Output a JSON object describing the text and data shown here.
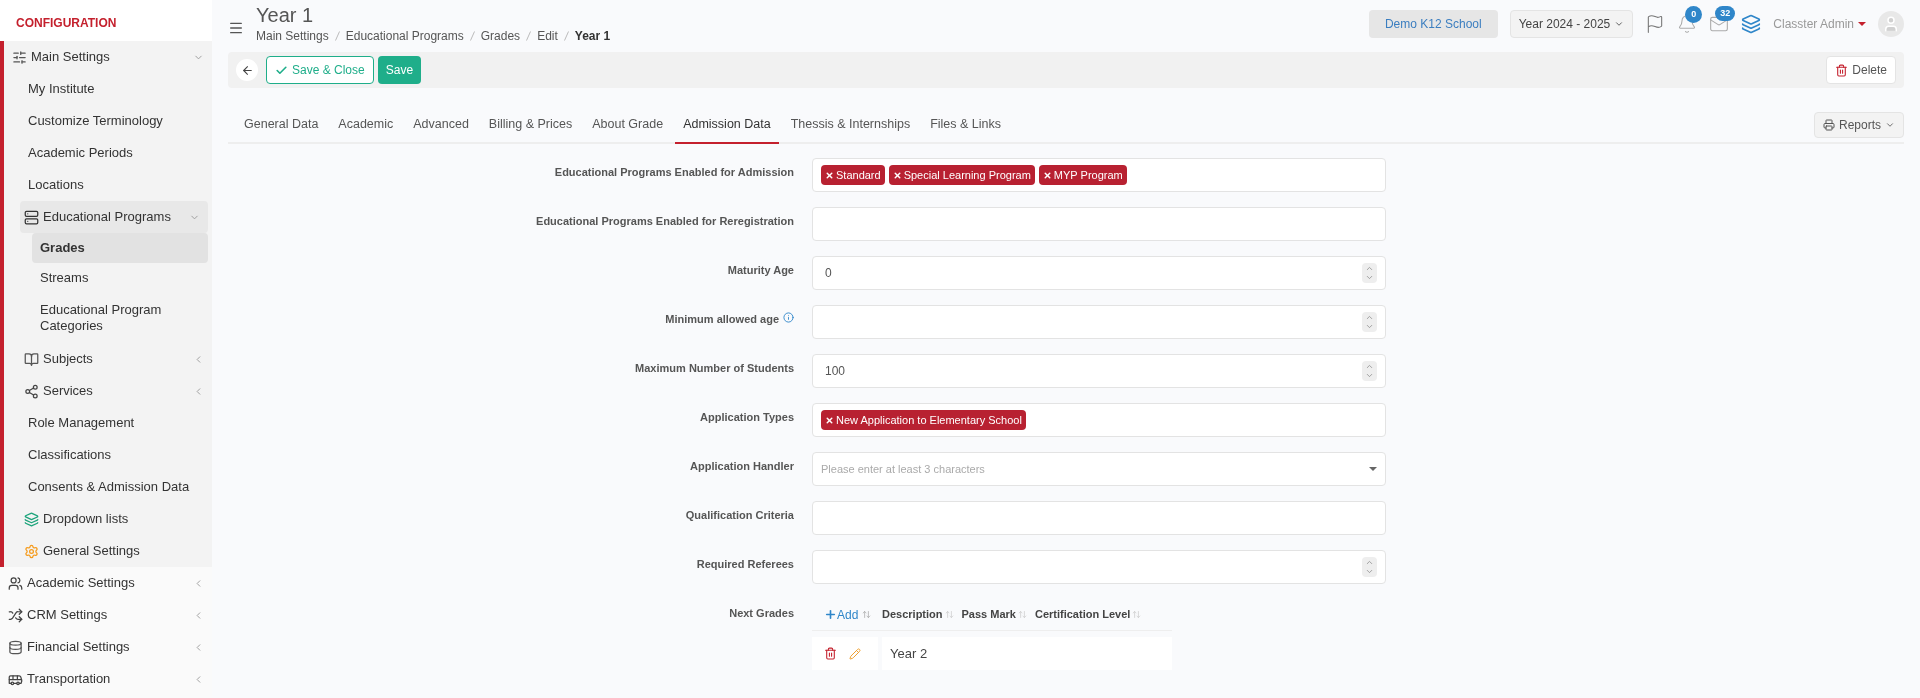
{
  "sidebar": {
    "heading": "CONFIGURATION",
    "items": [
      {
        "label": "Main Settings",
        "selected": false,
        "expanded": true,
        "children": [
          {
            "label": "My Institute",
            "selected": false
          },
          {
            "label": "Customize Terminology",
            "selected": false
          },
          {
            "label": "Academic Periods",
            "selected": false
          },
          {
            "label": "Locations",
            "selected": false
          },
          {
            "label": "Educational Programs",
            "selected": false,
            "expanded": true,
            "children": [
              {
                "label": "Grades",
                "selected": true
              },
              {
                "label": "Streams",
                "selected": false
              },
              {
                "label": "Educational Program Categories",
                "selected": false
              }
            ]
          },
          {
            "label": "Subjects",
            "selected": false,
            "expanded": false
          },
          {
            "label": "Services",
            "selected": false,
            "expanded": false
          },
          {
            "label": "Role Management",
            "selected": false
          },
          {
            "label": "Classifications",
            "selected": false
          },
          {
            "label": "Consents & Admission Data",
            "selected": false
          },
          {
            "label": "Dropdown lists",
            "selected": false
          },
          {
            "label": "General Settings",
            "selected": false
          }
        ]
      },
      {
        "label": "Academic Settings",
        "selected": false,
        "expanded": false
      },
      {
        "label": "CRM Settings",
        "selected": false,
        "expanded": false
      },
      {
        "label": "Financial Settings",
        "selected": false,
        "expanded": false
      },
      {
        "label": "Transportation",
        "selected": false,
        "expanded": false
      }
    ]
  },
  "header": {
    "title": "Year 1",
    "breadcrumb": [
      "Main Settings",
      "Educational Programs",
      "Grades",
      "Edit",
      "Year 1"
    ],
    "school": "Demo K12 School",
    "year": "Year 2024 - 2025",
    "notifications": "0",
    "messages": "32",
    "user": "Classter Admin"
  },
  "toolbar": {
    "save_close": "Save & Close",
    "save": "Save",
    "delete": "Delete"
  },
  "tabs": [
    {
      "label": "General Data",
      "selected": false
    },
    {
      "label": "Academic",
      "selected": false
    },
    {
      "label": "Advanced",
      "selected": false
    },
    {
      "label": "Billing & Prices",
      "selected": false
    },
    {
      "label": "About Grade",
      "selected": false
    },
    {
      "label": "Admission Data",
      "selected": true
    },
    {
      "label": "Thessis & Internships",
      "selected": false
    },
    {
      "label": "Files & Links",
      "selected": false
    }
  ],
  "reports": "Reports",
  "form": [
    {
      "label": "Educational Programs Enabled for Admission",
      "kind": "tags",
      "tags": [
        "Standard",
        "Special Learning Program",
        "MYP Program"
      ]
    },
    {
      "label": "Educational Programs Enabled for Reregistration",
      "kind": "tags"
    },
    {
      "label": "Maturity Age",
      "kind": "number",
      "value": "0"
    },
    {
      "label": "Minimum allowed age",
      "kind": "number",
      "info": true
    },
    {
      "label": "Maximum Number of Students",
      "kind": "number",
      "value": "100"
    },
    {
      "label": "Application Types",
      "kind": "tags",
      "tags": [
        "New Application to Elementary School"
      ]
    },
    {
      "label": "Application Handler",
      "kind": "select",
      "placeholder": "Please enter at least 3 characters"
    },
    {
      "label": "Qualification Criteria",
      "kind": "text"
    },
    {
      "label": "Required Referees",
      "kind": "number"
    },
    {
      "label": "Next Grades",
      "kind": "table",
      "add": "Add",
      "columns": [
        "Description",
        "Pass Mark",
        "Certification Level"
      ],
      "rows": [
        [
          "Year 2"
        ]
      ]
    }
  ]
}
